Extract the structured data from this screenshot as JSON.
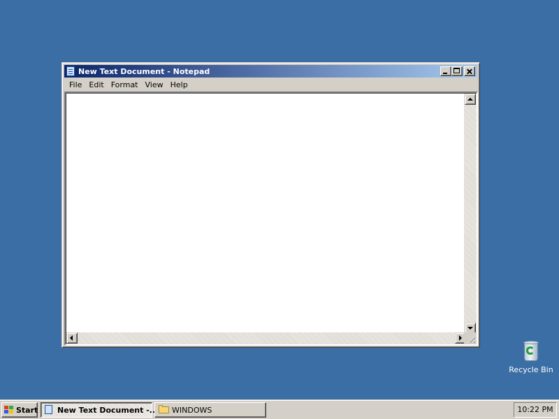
{
  "notepad": {
    "title": "New Text Document - Notepad",
    "menu": [
      "File",
      "Edit",
      "Format",
      "View",
      "Help"
    ],
    "text_content": ""
  },
  "desktop": {
    "background_color": "#3a6ea5",
    "icons": [
      {
        "label": "Recycle Bin",
        "icon": "recycle-bin-icon"
      }
    ]
  },
  "taskbar": {
    "start_label": "Start",
    "tasks": [
      {
        "label": "New Text Document -...",
        "icon": "notepad-icon",
        "active": true
      },
      {
        "label": "WINDOWS",
        "icon": "folder-icon",
        "active": false
      }
    ],
    "clock": "10:22 PM"
  }
}
